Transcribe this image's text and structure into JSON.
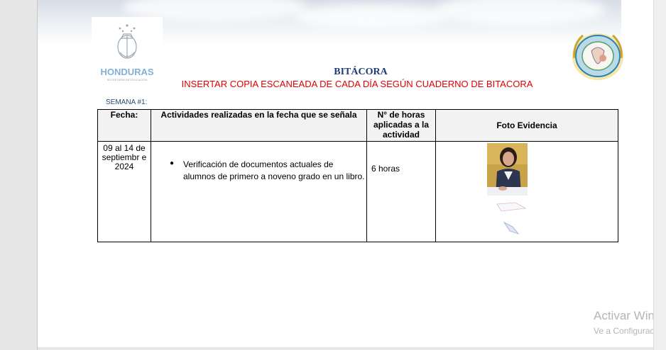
{
  "header": {
    "logo_name": "HONDURAS",
    "logo_subtitle": "SECRETARÍA DE EDUCACIÓN",
    "title": "BITÁCORA",
    "subtitle": "INSERTAR COPIA ESCANEADA DE CADA DÍA SEGÚN CUADERNO DE BITACORA"
  },
  "week_label": "SEMANA #1:",
  "table": {
    "columns": [
      "Fecha:",
      "Actividades realizadas en la fecha que se señala",
      "N° de horas aplicadas a la actividad",
      "Foto Evidencia"
    ],
    "rows": [
      {
        "date": "09 al 14 de septiembr e 2024",
        "activity": "Verificación de documentos actuales de alumnos de primero a noveno grado en un libro.",
        "hours": "6 horas"
      }
    ]
  },
  "watermark": {
    "line1": "Activar Win",
    "line2": "Ve a Configurac"
  },
  "colors": {
    "title": "#1f3a7a",
    "subtitle": "#e00000",
    "logo": "#7fb0d8"
  }
}
